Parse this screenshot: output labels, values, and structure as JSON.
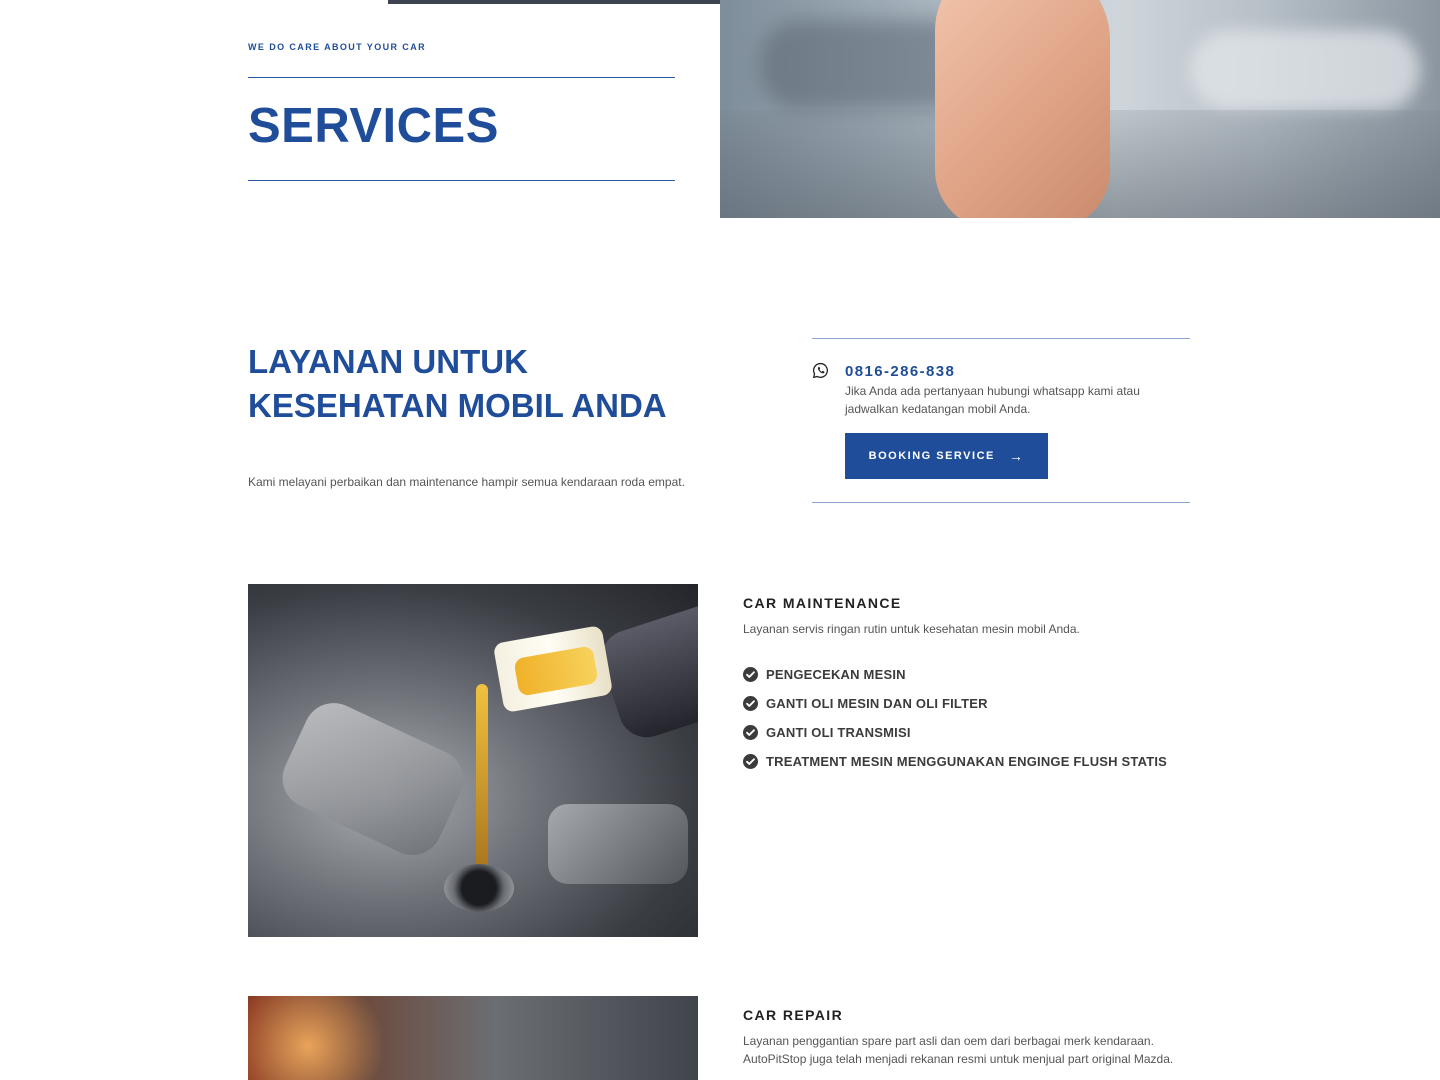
{
  "hero": {
    "tagline": "WE DO CARE ABOUT YOUR CAR",
    "title": "SERVICES",
    "image_alt": "hand holding a wrench in a workshop"
  },
  "intro": {
    "heading_line1": "LAYANAN UNTUK",
    "heading_line2": "KESEHATAN MOBIL ANDA",
    "text": "Kami melayani perbaikan dan maintenance hampir semua kendaraan roda empat."
  },
  "contact": {
    "icon": "whatsapp-icon",
    "phone": "0816-286-838",
    "text": "Jika Anda ada pertanyaan hubungi whatsapp kami atau jadwalkan kedatangan mobil Anda.",
    "button_label": "BOOKING SERVICE",
    "button_icon": "arrow-right-icon"
  },
  "services": [
    {
      "title": "CAR MAINTENANCE",
      "description": "Layanan servis ringan rutin untuk kesehatan mesin mobil Anda.",
      "image_alt": "engine oil being poured into an engine",
      "items": [
        "PENGECEKAN MESIN",
        "GANTI OLI MESIN DAN OLI FILTER",
        "GANTI OLI TRANSMISI",
        "TREATMENT MESIN MENGGUNAKAN ENGINGE FLUSH STATIS"
      ]
    },
    {
      "title": "CAR REPAIR",
      "description": "Layanan penggantian spare part asli dan oem dari berbagai merk kendaraan. AutoPitStop juga telah menjadi rekanan resmi untuk menjual part original Mazda.",
      "image_alt": "car repair in progress"
    }
  ],
  "colors": {
    "brand_blue": "#1f4d99",
    "line_blue": "#8ea6cf",
    "text": "#555555"
  }
}
